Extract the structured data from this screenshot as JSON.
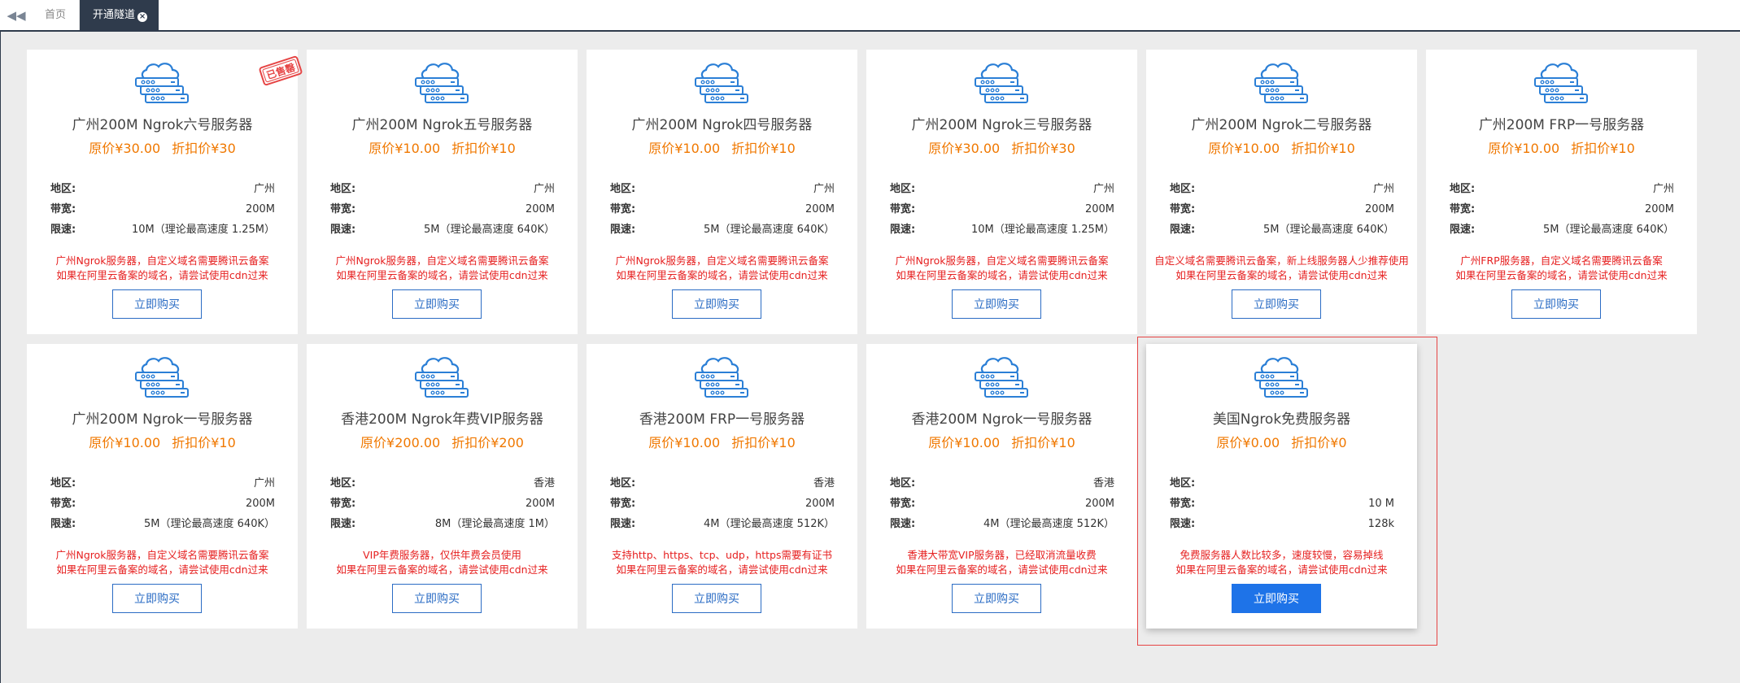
{
  "tabs": {
    "back_icon": "double-chevron-left-icon",
    "home": "首页",
    "active": "开通隧道",
    "close_icon": "close-circle-icon"
  },
  "labels": {
    "region": "地区:",
    "bandwidth": "带宽:",
    "limit": "限速:",
    "original_price_prefix": "原价",
    "discount_price_prefix": "折扣价"
  },
  "stamp_text": "已售罄",
  "colors": {
    "accent": "#1e73e8",
    "price": "#f07800",
    "notice": "#e62020",
    "tabbar": "#2f3b4c"
  },
  "servers": [
    {
      "title": "广州200M Ngrok六号服务器",
      "original": "¥30.00",
      "discount": "¥30",
      "region": "广州",
      "bandwidth": "200M",
      "limit": "10M（理论最高速度 1.25M）",
      "note1": "广州Ngrok服务器，自定义域名需要腾讯云备案",
      "note2": "如果在阿里云备案的域名，请尝试使用cdn过来",
      "button": "立即购买",
      "sold_out": true
    },
    {
      "title": "广州200M Ngrok五号服务器",
      "original": "¥10.00",
      "discount": "¥10",
      "region": "广州",
      "bandwidth": "200M",
      "limit": "5M（理论最高速度 640K）",
      "note1": "广州Ngrok服务器，自定义域名需要腾讯云备案",
      "note2": "如果在阿里云备案的域名，请尝试使用cdn过来",
      "button": "立即购买"
    },
    {
      "title": "广州200M Ngrok四号服务器",
      "original": "¥10.00",
      "discount": "¥10",
      "region": "广州",
      "bandwidth": "200M",
      "limit": "5M（理论最高速度 640K）",
      "note1": "广州Ngrok服务器，自定义域名需要腾讯云备案",
      "note2": "如果在阿里云备案的域名，请尝试使用cdn过来",
      "button": "立即购买"
    },
    {
      "title": "广州200M Ngrok三号服务器",
      "original": "¥30.00",
      "discount": "¥30",
      "region": "广州",
      "bandwidth": "200M",
      "limit": "10M（理论最高速度 1.25M）",
      "note1": "广州Ngrok服务器，自定义域名需要腾讯云备案",
      "note2": "如果在阿里云备案的域名，请尝试使用cdn过来",
      "button": "立即购买"
    },
    {
      "title": "广州200M Ngrok二号服务器",
      "original": "¥10.00",
      "discount": "¥10",
      "region": "广州",
      "bandwidth": "200M",
      "limit": "5M（理论最高速度 640K）",
      "note1": "自定义域名需要腾讯云备案，新上线服务器人少推荐使用",
      "note2": "如果在阿里云备案的域名，请尝试使用cdn过来",
      "button": "立即购买"
    },
    {
      "title": "广州200M FRP一号服务器",
      "original": "¥10.00",
      "discount": "¥10",
      "region": "广州",
      "bandwidth": "200M",
      "limit": "5M（理论最高速度 640K）",
      "note1": "广州FRP服务器，自定义域名需要腾讯云备案",
      "note2": "如果在阿里云备案的域名，请尝试使用cdn过来",
      "button": "立即购买"
    },
    {
      "title": "广州200M Ngrok一号服务器",
      "original": "¥10.00",
      "discount": "¥10",
      "region": "广州",
      "bandwidth": "200M",
      "limit": "5M（理论最高速度 640K）",
      "note1": "广州Ngrok服务器，自定义域名需要腾讯云备案",
      "note2": "如果在阿里云备案的域名，请尝试使用cdn过来",
      "button": "立即购买"
    },
    {
      "title": "香港200M Ngrok年费VIP服务器",
      "original": "¥200.00",
      "discount": "¥200",
      "region": "香港",
      "bandwidth": "200M",
      "limit": "8M（理论最高速度 1M）",
      "note1": "VIP年费服务器，仅供年费会员使用",
      "note2": "如果在阿里云备案的域名，请尝试使用cdn过来",
      "button": "立即购买"
    },
    {
      "title": "香港200M FRP一号服务器",
      "original": "¥10.00",
      "discount": "¥10",
      "region": "香港",
      "bandwidth": "200M",
      "limit": "4M（理论最高速度 512K）",
      "note1": "支持http、https、tcp、udp，https需要有证书",
      "note2": "如果在阿里云备案的域名，请尝试使用cdn过来",
      "button": "立即购买"
    },
    {
      "title": "香港200M Ngrok一号服务器",
      "original": "¥10.00",
      "discount": "¥10",
      "region": "香港",
      "bandwidth": "200M",
      "limit": "4M（理论最高速度 512K）",
      "note1": "香港大带宽VIP服务器，已经取消流量收费",
      "note2": "如果在阿里云备案的域名，请尝试使用cdn过来",
      "button": "立即购买"
    },
    {
      "title": "美国Ngrok免费服务器",
      "original": "¥0.00",
      "discount": "¥0",
      "region": "",
      "bandwidth": "10 M",
      "limit": "128k",
      "note1": "免费服务器人数比较多，速度较慢，容易掉线",
      "note2": "如果在阿里云备案的域名，请尝试使用cdn过来",
      "button": "立即购买",
      "highlighted": true
    }
  ]
}
